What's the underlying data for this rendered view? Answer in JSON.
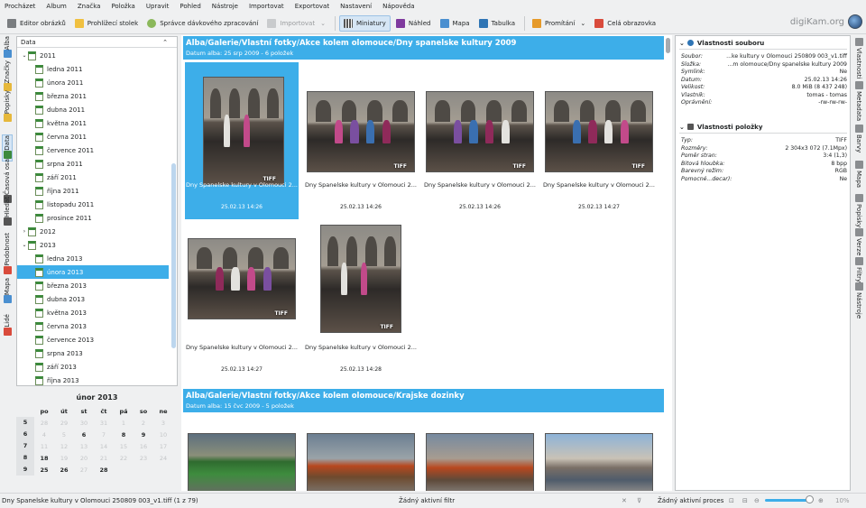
{
  "menu": [
    "Procházet",
    "Album",
    "Značka",
    "Položka",
    "Upravit",
    "Pohled",
    "Nástroje",
    "Importovat",
    "Exportovat",
    "Nastavení",
    "Nápověda"
  ],
  "toolbar": {
    "editor": "Editor obrázků",
    "light_table": "Prohlížecí stolek",
    "batch": "Správce dávkového zpracování",
    "import": "Importovat",
    "thumbnails": "Miniatury",
    "preview": "Náhled",
    "map": "Mapa",
    "table": "Tabulka",
    "slideshow": "Promítání",
    "fullscreen": "Celá obrazovka"
  },
  "brand": "digiKam.org",
  "left_tabs": [
    "Alba",
    "Značky",
    "Popisky",
    "Data",
    "Časová osa",
    "Hledat",
    "Podobnost",
    "Mapa",
    "Lidé"
  ],
  "right_tabs": [
    "Vlastnosti",
    "Metadata",
    "Barvy",
    "Mapa",
    "Popisky",
    "Verze",
    "Filtry",
    "Nástroje"
  ],
  "tree": {
    "header": "Data",
    "rows": [
      {
        "label": "2011",
        "level": 0,
        "arrow": "⌄"
      },
      {
        "label": "ledna 2011",
        "level": 1
      },
      {
        "label": "února 2011",
        "level": 1
      },
      {
        "label": "března 2011",
        "level": 1
      },
      {
        "label": "dubna 2011",
        "level": 1
      },
      {
        "label": "května 2011",
        "level": 1
      },
      {
        "label": "června 2011",
        "level": 1
      },
      {
        "label": "července 2011",
        "level": 1
      },
      {
        "label": "srpna 2011",
        "level": 1
      },
      {
        "label": "září 2011",
        "level": 1
      },
      {
        "label": "října 2011",
        "level": 1
      },
      {
        "label": "listopadu 2011",
        "level": 1
      },
      {
        "label": "prosince 2011",
        "level": 1
      },
      {
        "label": "2012",
        "level": 0,
        "arrow": "›"
      },
      {
        "label": "2013",
        "level": 0,
        "arrow": "⌄"
      },
      {
        "label": "ledna 2013",
        "level": 1
      },
      {
        "label": "února 2013",
        "level": 1,
        "selected": true
      },
      {
        "label": "března 2013",
        "level": 1
      },
      {
        "label": "dubna 2013",
        "level": 1
      },
      {
        "label": "května 2013",
        "level": 1
      },
      {
        "label": "června 2013",
        "level": 1
      },
      {
        "label": "července 2013",
        "level": 1
      },
      {
        "label": "srpna 2013",
        "level": 1
      },
      {
        "label": "září 2013",
        "level": 1
      },
      {
        "label": "října 2013",
        "level": 1
      }
    ]
  },
  "calendar": {
    "title": "únor 2013",
    "days": [
      "po",
      "út",
      "st",
      "čt",
      "pá",
      "so",
      "ne"
    ],
    "weeks": [
      {
        "wk": "5",
        "cells": [
          {
            "v": "28",
            "s": "dim"
          },
          {
            "v": "29",
            "s": "dim"
          },
          {
            "v": "30",
            "s": "dim"
          },
          {
            "v": "31",
            "s": "dim"
          },
          {
            "v": "1",
            "s": "dim"
          },
          {
            "v": "2",
            "s": "dim"
          },
          {
            "v": "3",
            "s": "dim"
          }
        ]
      },
      {
        "wk": "6",
        "cells": [
          {
            "v": "4",
            "s": "dim"
          },
          {
            "v": "5",
            "s": "dim"
          },
          {
            "v": "6",
            "s": "bold"
          },
          {
            "v": "7",
            "s": "dim"
          },
          {
            "v": "8",
            "s": "bold"
          },
          {
            "v": "9",
            "s": "bold"
          },
          {
            "v": "10",
            "s": "dim"
          }
        ]
      },
      {
        "wk": "7",
        "cells": [
          {
            "v": "11",
            "s": "dim"
          },
          {
            "v": "12",
            "s": "dim"
          },
          {
            "v": "13",
            "s": "dim"
          },
          {
            "v": "14",
            "s": "dim"
          },
          {
            "v": "15",
            "s": "dim"
          },
          {
            "v": "16",
            "s": "dim"
          },
          {
            "v": "17",
            "s": "dim"
          }
        ]
      },
      {
        "wk": "8",
        "cells": [
          {
            "v": "18",
            "s": "bold"
          },
          {
            "v": "19",
            "s": "dim"
          },
          {
            "v": "20",
            "s": "dim"
          },
          {
            "v": "21",
            "s": "dim"
          },
          {
            "v": "22",
            "s": "dim"
          },
          {
            "v": "23",
            "s": "dim"
          },
          {
            "v": "24",
            "s": "dim"
          }
        ]
      },
      {
        "wk": "9",
        "cells": [
          {
            "v": "25",
            "s": "bold"
          },
          {
            "v": "26",
            "s": "bold"
          },
          {
            "v": "27",
            "s": "dim"
          },
          {
            "v": "28",
            "s": "bold"
          },
          {
            "v": "",
            "s": ""
          },
          {
            "v": "",
            "s": ""
          },
          {
            "v": "",
            "s": ""
          }
        ]
      }
    ]
  },
  "groups": [
    {
      "title": "Alba/Galerie/Vlastní fotky/Akce kolem olomouce/Dny spanelske kultury 2009",
      "subtitle": "Datum alba: 25 srp 2009 - 6 položek"
    },
    {
      "title": "Alba/Galerie/Vlastní fotky/Akce kolem olomouce/Krajske dozinky",
      "subtitle": "Datum alba: 15 čvc 2009 - 5 položek"
    }
  ],
  "thumbs": [
    {
      "name": "Dny Spanelske kultury v Olomouci  2...",
      "date": "25.02.13 14:26",
      "badge": "TIFF",
      "selected": true
    },
    {
      "name": "Dny Spanelske kultury v Olomouci  2...",
      "date": "25.02.13 14:26",
      "badge": "TIFF"
    },
    {
      "name": "Dny Spanelske kultury v Olomouci  2...",
      "date": "25.02.13 14:26",
      "badge": "TIFF"
    },
    {
      "name": "Dny Spanelske kultury v Olomouci  2...",
      "date": "25.02.13 14:27",
      "badge": "TIFF"
    },
    {
      "name": "Dny Spanelske kultury v Olomouci  2...",
      "date": "25.02.13 14:27",
      "badge": "TIFF"
    },
    {
      "name": "Dny Spanelske kultury v Olomouci  2...",
      "date": "25.02.13 14:28",
      "badge": "TIFF"
    }
  ],
  "file_props": {
    "title": "Vlastnosti souboru",
    "rows": [
      {
        "k": "Soubor:",
        "v": "...ke kultury v Olomouci  250809 003_v1.tiff"
      },
      {
        "k": "Složka:",
        "v": "...m olomouce/Dny spanelske kultury 2009"
      },
      {
        "k": "Symlink:",
        "v": "Ne"
      },
      {
        "k": "Datum:",
        "v": "25.02.13 14:26"
      },
      {
        "k": "Velikost:",
        "v": "8.0 MiB (8 437 248)"
      },
      {
        "k": "Vlastník:",
        "v": "tomas - tomas"
      },
      {
        "k": "Oprávnění:",
        "v": "-rw-rw-rw-"
      }
    ]
  },
  "item_props": {
    "title": "Vlastnosti položky",
    "rows": [
      {
        "k": "Typ:",
        "v": "TIFF"
      },
      {
        "k": "Rozměry:",
        "v": "2 304x3 072 (7.1Mpx)"
      },
      {
        "k": "Poměr stran:",
        "v": "3:4 (1,3)"
      },
      {
        "k": "Bitová hloubka:",
        "v": "8 bpp"
      },
      {
        "k": "Barevný režim:",
        "v": "RGB"
      },
      {
        "k": "Pomocné...decar):",
        "v": "Ne"
      }
    ]
  },
  "status": {
    "file": "Dny Spanelske kultury v Olomouci  250809 003_v1.tiff (1 z 79)",
    "filter": "Žádný aktivní filtr",
    "process": "Žádný aktivní proces",
    "zoom": "10%"
  }
}
